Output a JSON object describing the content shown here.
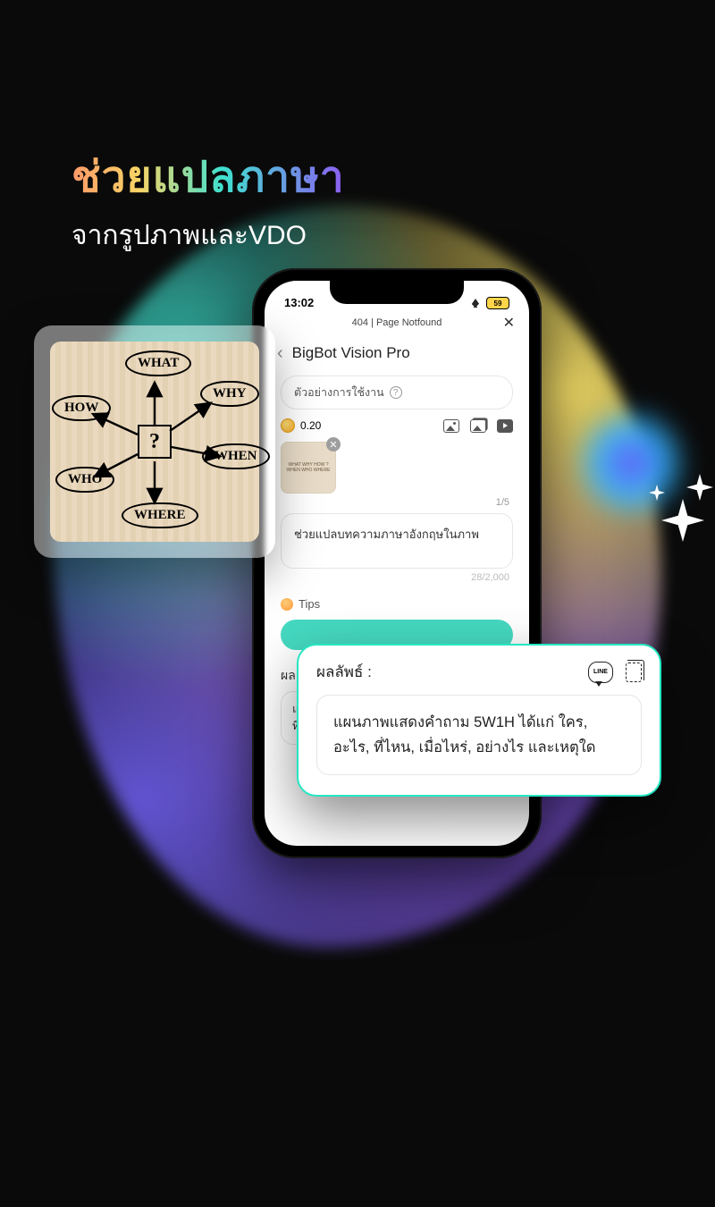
{
  "headline": {
    "title": "ช่วยแปลภาษา",
    "subtitle": "จากรูปภาพและVDO"
  },
  "phone": {
    "status": {
      "time": "13:02",
      "battery": "59"
    },
    "window_title": "404 | Page Notfound",
    "app_title": "BigBot Vision Pro",
    "example_label": "ตัวอย่างการใช้งาน",
    "credit": "0.20",
    "image_counter": "1/5",
    "prompt_text": "ช่วยแปลบทความภาษาอังกฤษในภาพ",
    "char_counter": "28/2,000",
    "tips_label": "Tips",
    "result_label": "ผลลัพธ์ :",
    "result_snippet_line1": "แผนภ",
    "result_snippet_line2": "ที่ไหน,"
  },
  "diagram": {
    "center": "?",
    "nodes": {
      "what": "WHAT",
      "why": "WHY",
      "when": "WHEN",
      "where": "WHERE",
      "who": "WHO",
      "how": "HOW"
    }
  },
  "result_card": {
    "title": "ผลลัพธ์ :",
    "line_badge": "LINE",
    "body": "แผนภาพแสดงคำถาม 5W1H ได้แก่ ใคร, อะไร, ที่ไหน, เมื่อไหร่, อย่างไร และเหตุใด"
  },
  "thumb_mini": "WHAT WHY\nHOW ? WHEN\nWHO\nWHERE"
}
